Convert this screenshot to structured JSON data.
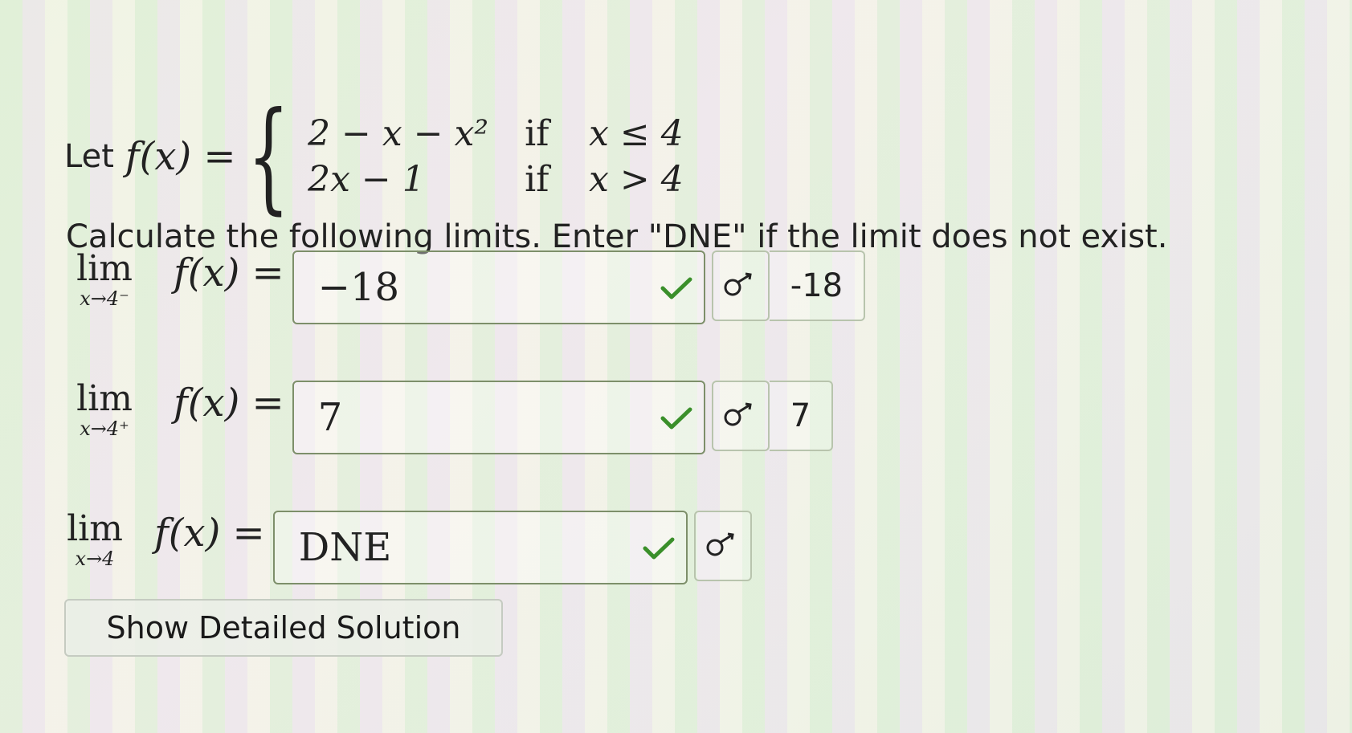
{
  "problem": {
    "let_label": "Let",
    "function_def": "f(x) =",
    "cases": [
      {
        "expr": "2 − x − x²",
        "if": "if",
        "condition": "x ≤ 4"
      },
      {
        "expr": "2x − 1",
        "if": "if",
        "condition": "x > 4"
      }
    ],
    "instructions": "Calculate the following limits. Enter \"DNE\" if the limit does not exist."
  },
  "limits": [
    {
      "lim": "lim",
      "subscript": "x→4⁻",
      "rhs": "f(x) =",
      "answer": "−18",
      "preview": "-18",
      "status": "correct"
    },
    {
      "lim": "lim",
      "subscript": "x→4⁺",
      "rhs": "f(x) =",
      "answer": "7",
      "preview": "7",
      "status": "correct"
    },
    {
      "lim": "lim",
      "subscript": "x→4",
      "rhs": "f(x) =",
      "answer": "DNE",
      "preview": "",
      "status": "correct"
    }
  ],
  "buttons": {
    "show_solution": "Show Detailed Solution"
  },
  "icons": {
    "check": "check-icon",
    "key": "key-icon"
  },
  "colors": {
    "check": "#3a8f2a",
    "box_border": "#7d8f6a"
  }
}
